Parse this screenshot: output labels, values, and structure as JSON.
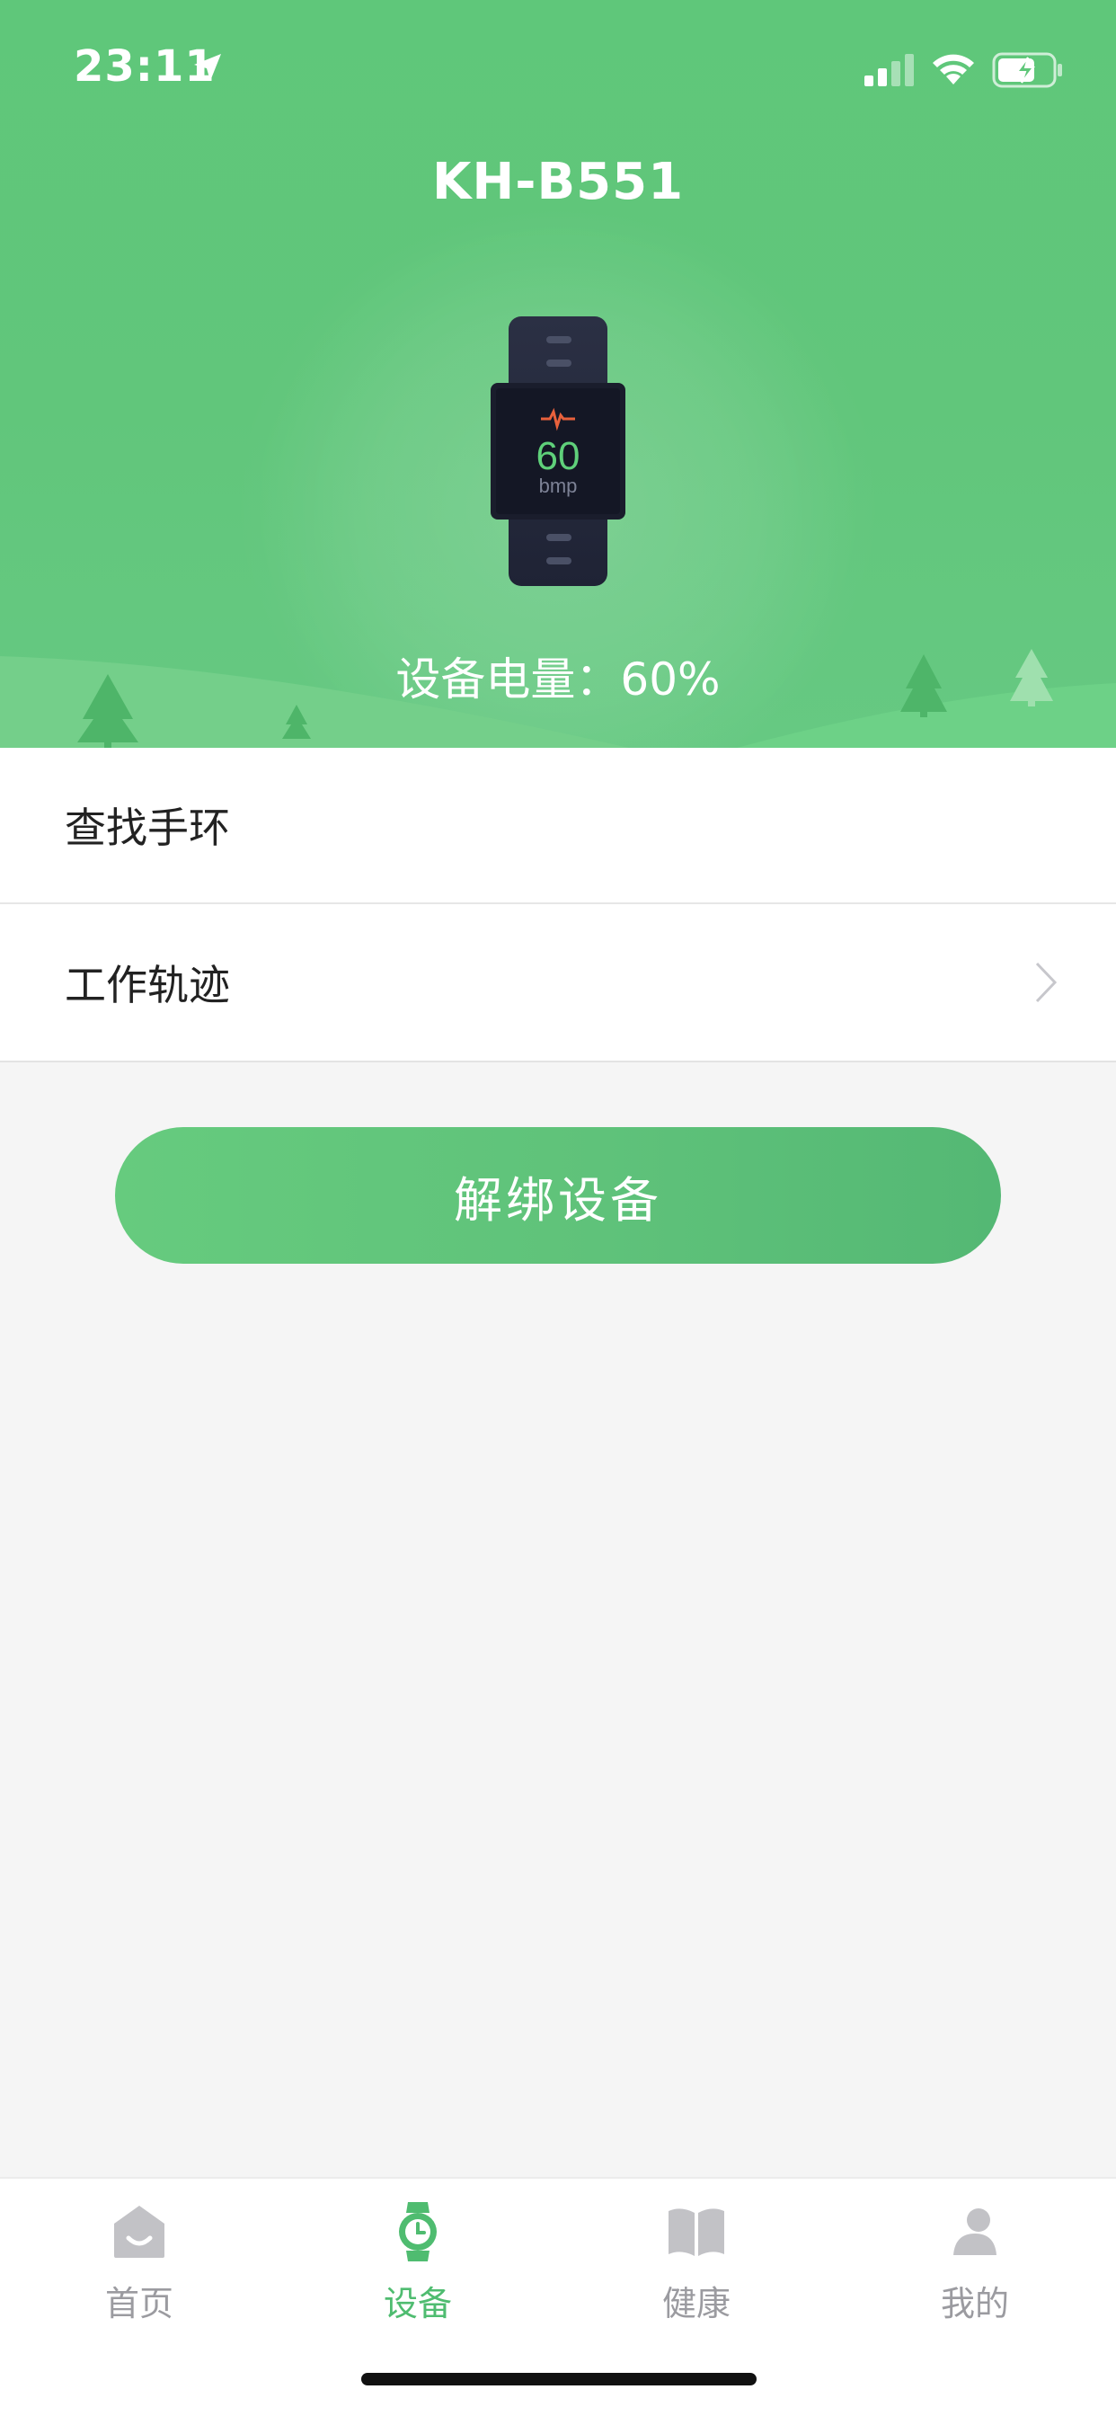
{
  "status_bar": {
    "time": "23:11"
  },
  "header": {
    "device_name": "KH-B551",
    "band_screen": {
      "heart_rate": "60",
      "unit": "bmp"
    },
    "battery_text": "设备电量：60%"
  },
  "list": {
    "items": [
      {
        "label": "查找手环",
        "has_chevron": false
      },
      {
        "label": "工作轨迹",
        "has_chevron": true
      }
    ]
  },
  "actions": {
    "unbind_label": "解绑设备"
  },
  "tabbar": {
    "tabs": [
      {
        "label": "首页",
        "icon": "home-icon",
        "active": false
      },
      {
        "label": "设备",
        "icon": "watch-icon",
        "active": true
      },
      {
        "label": "健康",
        "icon": "book-icon",
        "active": false
      },
      {
        "label": "我的",
        "icon": "person-icon",
        "active": false
      }
    ]
  },
  "colors": {
    "accent": "#5fc77a",
    "active_tab": "#4fbc70",
    "inactive_tab": "#9b9ba0"
  }
}
